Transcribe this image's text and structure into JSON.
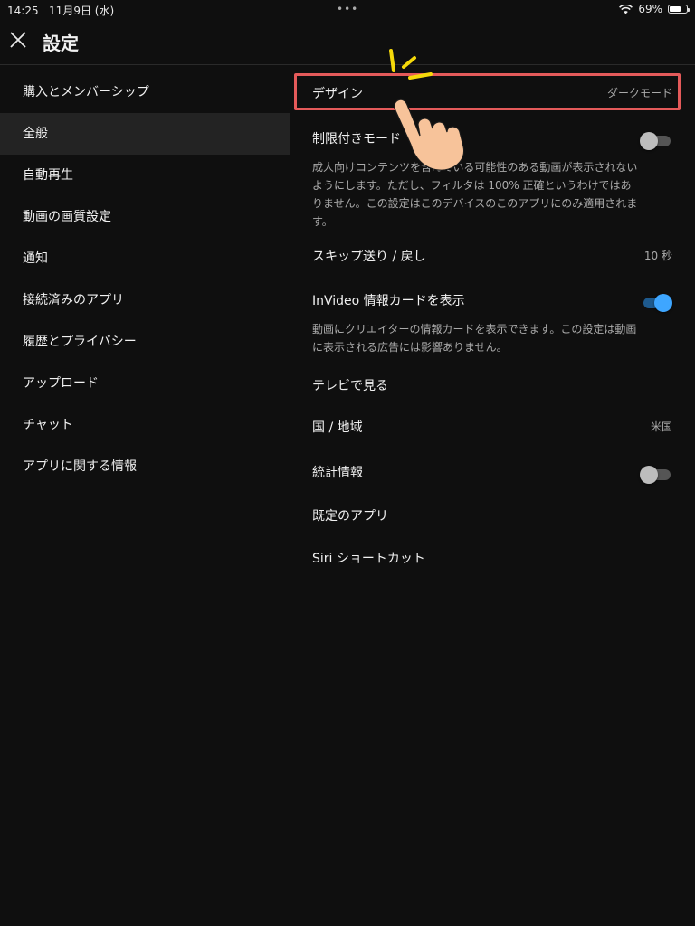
{
  "status": {
    "time": "14:25",
    "date": "11月9日 (水)",
    "battery": "69%",
    "battery_level": 0.69,
    "dots": "•••"
  },
  "header": {
    "title": "設定",
    "close_icon": "close-icon"
  },
  "sidebar": {
    "items": [
      {
        "label": "購入とメンバーシップ",
        "active": false
      },
      {
        "label": "全般",
        "active": true
      },
      {
        "label": "自動再生",
        "active": false
      },
      {
        "label": "動画の画質設定",
        "active": false
      },
      {
        "label": "通知",
        "active": false
      },
      {
        "label": "接続済みのアプリ",
        "active": false
      },
      {
        "label": "履歴とプライバシー",
        "active": false
      },
      {
        "label": "アップロード",
        "active": false
      },
      {
        "label": "チャット",
        "active": false
      },
      {
        "label": "アプリに関する情報",
        "active": false
      }
    ]
  },
  "settings": {
    "design": {
      "label": "デザイン",
      "value": "ダークモード"
    },
    "restricted": {
      "label": "制限付きモード",
      "toggle": false,
      "desc": "成人向けコンテンツを含んでいる可能性のある動画が表示されないようにします。ただし、フィルタは 100% 正確というわけではありません。この設定はこのデバイスのこのアプリにのみ適用されます。"
    },
    "skip": {
      "label": "スキップ送り / 戻し",
      "value": "10 秒"
    },
    "infocards": {
      "label": "InVideo 情報カードを表示",
      "toggle": true,
      "desc": "動画にクリエイターの情報カードを表示できます。この設定は動画に表示される広告には影響ありません。"
    },
    "tv": {
      "label": "テレビで見る"
    },
    "region": {
      "label": "国 / 地域",
      "value": "米国"
    },
    "stats": {
      "label": "統計情報",
      "toggle": false
    },
    "default_app": {
      "label": "既定のアプリ"
    },
    "siri": {
      "label": "Siri ショートカット"
    }
  },
  "colors": {
    "background": "#0f0f0f",
    "accent": "#3ea6ff",
    "highlight": "#e45a5a"
  }
}
